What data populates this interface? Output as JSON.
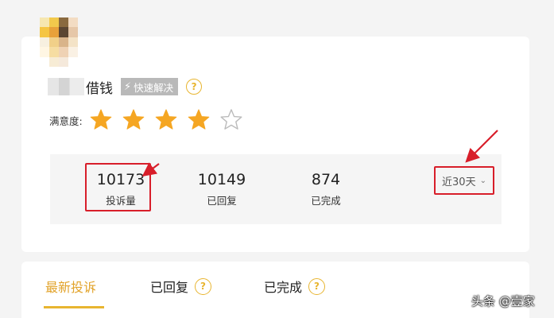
{
  "profile": {
    "name_visible": "借钱",
    "quick_badge": "快速解决",
    "help_glyph": "?"
  },
  "rating": {
    "label": "满意度:",
    "value": 4,
    "max": 5,
    "star_color": "#f5a623"
  },
  "stats": [
    {
      "value": "10173",
      "label": "投诉量"
    },
    {
      "value": "10149",
      "label": "已回复"
    },
    {
      "value": "874",
      "label": "已完成"
    }
  ],
  "period": {
    "label": "近30天"
  },
  "tabs": [
    {
      "label": "最新投诉",
      "active": true
    },
    {
      "label": "已回复",
      "active": false
    },
    {
      "label": "已完成",
      "active": false
    }
  ],
  "watermark": "头条 @壹家",
  "colors": {
    "accent": "#e8b530",
    "annotation": "#d81e2a"
  }
}
